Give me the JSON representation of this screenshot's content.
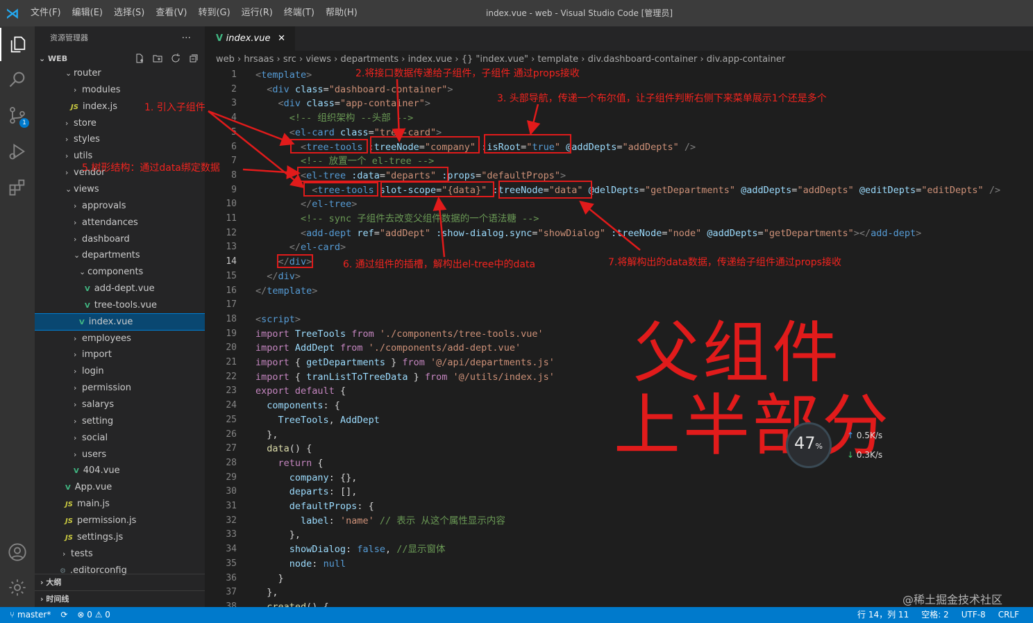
{
  "window": {
    "menu": [
      "文件(F)",
      "编辑(E)",
      "选择(S)",
      "查看(V)",
      "转到(G)",
      "运行(R)",
      "终端(T)",
      "帮助(H)"
    ],
    "title": "index.vue - web - Visual Studio Code [管理员]"
  },
  "activity_bar": {
    "scm_badge": "1"
  },
  "sidebar": {
    "title": "资源管理器",
    "more": "···",
    "section": "WEB",
    "items": [
      {
        "label": "router",
        "chev": "⌄",
        "indent": 44
      },
      {
        "label": "modules",
        "chev": "›",
        "indent": 56
      },
      {
        "label": "index.js",
        "icon": "JS",
        "indent": 52
      },
      {
        "label": "store",
        "chev": "›",
        "indent": 44
      },
      {
        "label": "styles",
        "chev": "›",
        "indent": 44
      },
      {
        "label": "utils",
        "chev": "›",
        "indent": 44
      },
      {
        "label": "vendor",
        "chev": "›",
        "indent": 44
      },
      {
        "label": "views",
        "chev": "⌄",
        "indent": 44
      },
      {
        "label": "approvals",
        "chev": "›",
        "indent": 56
      },
      {
        "label": "attendances",
        "chev": "›",
        "indent": 56
      },
      {
        "label": "dashboard",
        "chev": "›",
        "indent": 56
      },
      {
        "label": "departments",
        "chev": "⌄",
        "indent": 56
      },
      {
        "label": "components",
        "chev": "⌄",
        "indent": 64
      },
      {
        "label": "add-dept.vue",
        "icon": "V",
        "indent": 72
      },
      {
        "label": "tree-tools.vue",
        "icon": "V",
        "indent": 72
      },
      {
        "label": "index.vue",
        "icon": "V",
        "indent": 64,
        "selected": true
      },
      {
        "label": "employees",
        "chev": "›",
        "indent": 56
      },
      {
        "label": "import",
        "chev": "›",
        "indent": 56
      },
      {
        "label": "login",
        "chev": "›",
        "indent": 56
      },
      {
        "label": "permission",
        "chev": "›",
        "indent": 56
      },
      {
        "label": "salarys",
        "chev": "›",
        "indent": 56
      },
      {
        "label": "setting",
        "chev": "›",
        "indent": 56
      },
      {
        "label": "social",
        "chev": "›",
        "indent": 56
      },
      {
        "label": "users",
        "chev": "›",
        "indent": 56
      },
      {
        "label": "404.vue",
        "icon": "V",
        "indent": 56
      },
      {
        "label": "App.vue",
        "icon": "V",
        "indent": 44
      },
      {
        "label": "main.js",
        "icon": "JS",
        "indent": 44
      },
      {
        "label": "permission.js",
        "icon": "JS",
        "indent": 44
      },
      {
        "label": "settings.js",
        "icon": "JS",
        "indent": 44
      },
      {
        "label": "tests",
        "chev": "›",
        "indent": 40
      },
      {
        "label": ".editorconfig",
        "icon": "⚙",
        "indent": 36
      }
    ],
    "outline": "大纲",
    "timeline": "时间线"
  },
  "editor": {
    "tab": {
      "label": "index.vue",
      "close": "✕"
    },
    "breadcrumb": "web › hrsaas › src › views › departments › index.vue › {} \"index.vue\" › template › div.dashboard-container › div.app-container",
    "current_line": 14
  },
  "annotations": {
    "a1": "1. 引入子组件",
    "a2": "2.将接口数据传递给子组件，子组件 通过props接收",
    "a3": "3. 头部导航，传递一个布尔值，让子组件判断右侧下来菜单展示1个还是多个",
    "a5": "5.树形结构：通过data绑定数据",
    "a6": "6. 通过组件的插槽，解构出el-tree中的data",
    "a7": "7.将解构出的data数据，传递给子组件通过props接收",
    "big1": "父组件",
    "big2": "上半部分"
  },
  "widget": {
    "percent": "47",
    "unit": "%",
    "up": "0.5K/s",
    "down": "0.3K/s"
  },
  "watermark": "@稀土掘金技术社区",
  "statusbar": {
    "branch": "master*",
    "sync": "⟳",
    "problems": "⊗ 0 ⚠ 0",
    "position": "行 14，列 11",
    "spaces": "空格: 2",
    "encoding": "UTF-8",
    "eol": "CRLF"
  },
  "colors": {
    "accent": "#007acc",
    "annotation": "#e11b1b",
    "selection": "#094771"
  }
}
